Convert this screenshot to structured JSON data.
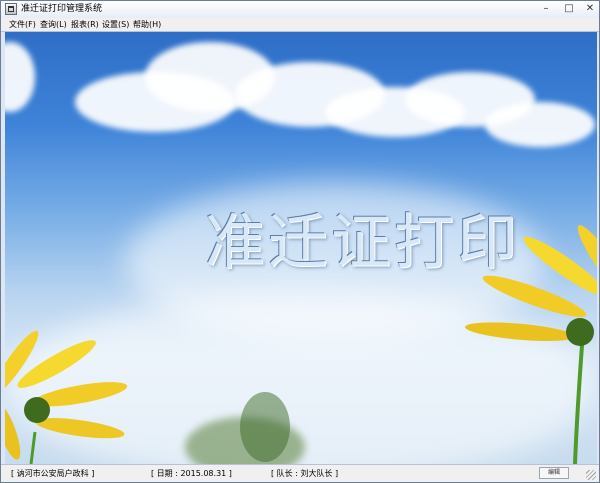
{
  "window": {
    "title": "准迁证打印管理系统",
    "controls": {
      "minimize": "–",
      "maximize": "□",
      "close": "✕"
    }
  },
  "menu": [
    {
      "label": "文件(F)"
    },
    {
      "label": "查询(L)"
    },
    {
      "label": "报表(R)"
    },
    {
      "label": "设置(S)"
    },
    {
      "label": "帮助(H)"
    }
  ],
  "main": {
    "banner_text": "准迁证打印"
  },
  "status": {
    "department": "[ 讷河市公安局户政科 ]",
    "date": "[ 日期 : 2015.08.31 ]",
    "leader": "[ 队长 : 刘大队长 ]",
    "box_label": "编辑"
  }
}
